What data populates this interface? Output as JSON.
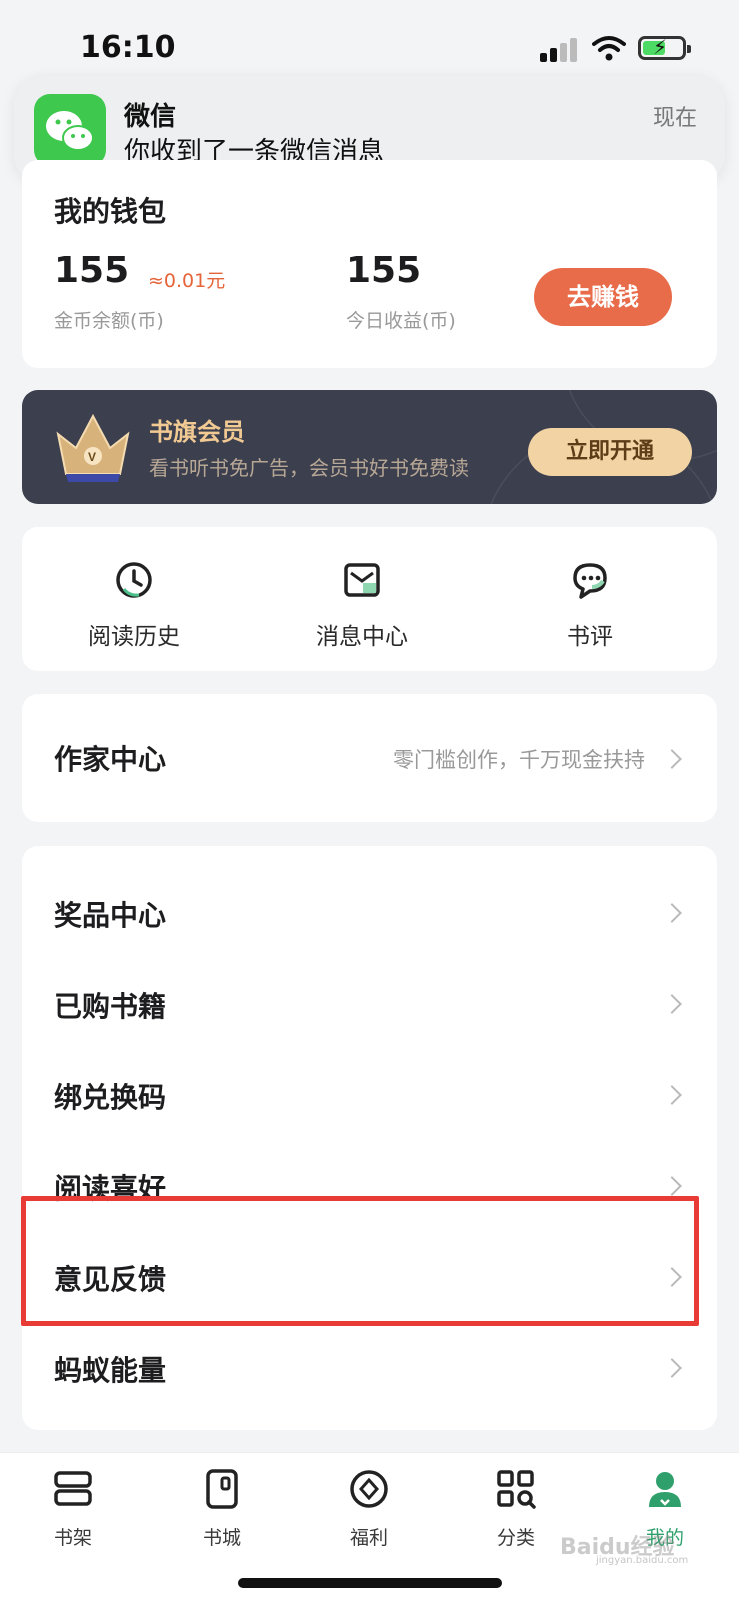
{
  "status_bar": {
    "time": "16:10"
  },
  "notification": {
    "app_name": "微信",
    "message": "你收到了一条微信消息",
    "time": "现在",
    "icon": "wechat-icon"
  },
  "wallet": {
    "title": "我的钱包",
    "coin_balance": "155",
    "coin_value": "≈0.01元",
    "coin_label": "金币余额(币)",
    "today_income": "155",
    "today_label": "今日收益(币)",
    "earn_button": "去赚钱"
  },
  "vip": {
    "title": "书旗会员",
    "subtitle": "看书听书免广告，会员书好书免费读",
    "button": "立即开通",
    "icon": "crown-icon"
  },
  "shortcuts": [
    {
      "label": "阅读历史",
      "icon": "clock-icon"
    },
    {
      "label": "消息中心",
      "icon": "inbox-icon"
    },
    {
      "label": "书评",
      "icon": "chat-bubble-icon"
    }
  ],
  "writer": {
    "label": "作家中心",
    "description": "零门槛创作，千万现金扶持"
  },
  "menu": [
    {
      "label": "奖品中心"
    },
    {
      "label": "已购书籍"
    },
    {
      "label": "绑兑换码"
    },
    {
      "label": "阅读喜好"
    },
    {
      "label": "意见反馈"
    },
    {
      "label": "蚂蚁能量"
    }
  ],
  "tabs": [
    {
      "label": "书架",
      "icon": "bookshelf-icon"
    },
    {
      "label": "书城",
      "icon": "bookstore-icon"
    },
    {
      "label": "福利",
      "icon": "welfare-icon"
    },
    {
      "label": "分类",
      "icon": "category-icon"
    },
    {
      "label": "我的",
      "icon": "profile-icon",
      "active": true
    }
  ],
  "watermark": {
    "text": "Baidu经验",
    "sub": "jingyan.baidu.com"
  },
  "colors": {
    "accent_green": "#2fa06c",
    "earn_orange": "#e86b4a",
    "vip_gold": "#f2d3a3",
    "highlight_red": "#e93b36"
  }
}
